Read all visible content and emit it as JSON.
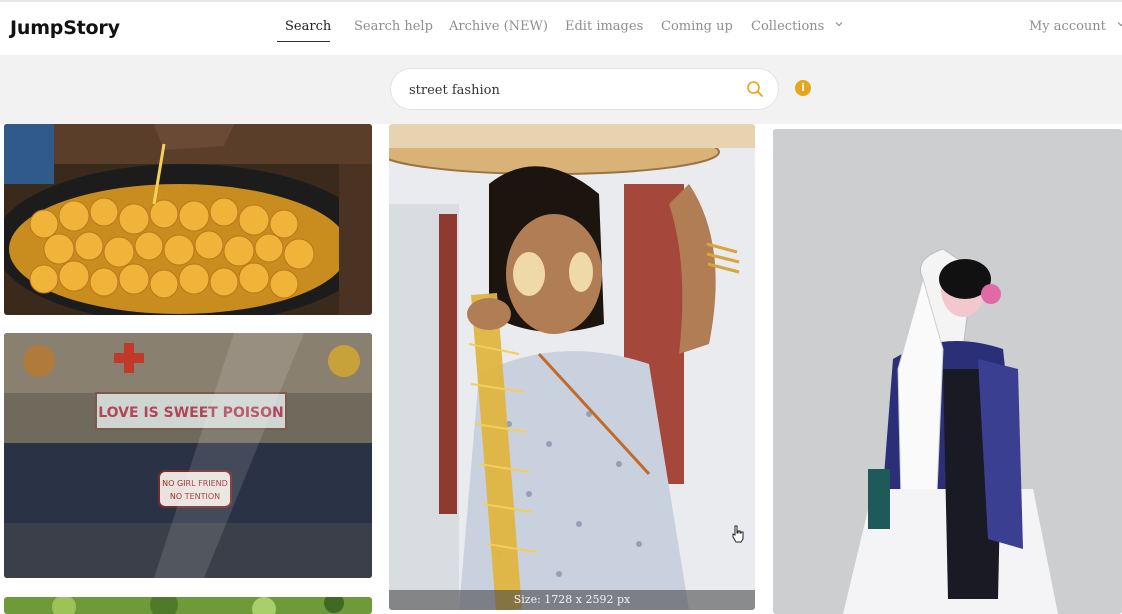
{
  "brand": {
    "logo_text": "JumpStory"
  },
  "nav": {
    "items": [
      {
        "label": "Search",
        "active": true
      },
      {
        "label": "Search help"
      },
      {
        "label": "Archive (NEW)"
      },
      {
        "label": "Edit images"
      },
      {
        "label": "Coming up"
      },
      {
        "label": "Collections",
        "icon": "chevron-down-icon"
      }
    ],
    "account_label": "My account"
  },
  "search": {
    "query": "street fashion",
    "icon": "search-icon",
    "info_icon": "info-icon",
    "info_glyph": "i",
    "accent_color": "#e6a51b"
  },
  "results": {
    "hovered_size_label": "Size: 1728 x 2592 px",
    "images": [
      {
        "subject": "fried-dough-balls-in-pan"
      },
      {
        "subject": "painted-truck-love-is-sweet-poison"
      },
      {
        "subject": "girl-with-thanaka-and-basket"
      },
      {
        "subject": "chinese-opera-performer"
      },
      {
        "subject": "green-foliage"
      }
    ],
    "truck_sign_text": "LOVE IS SWEET POISON",
    "truck_plate_line1": "NO GIRL FRIEND",
    "truck_plate_line2": "NO TENTION"
  }
}
